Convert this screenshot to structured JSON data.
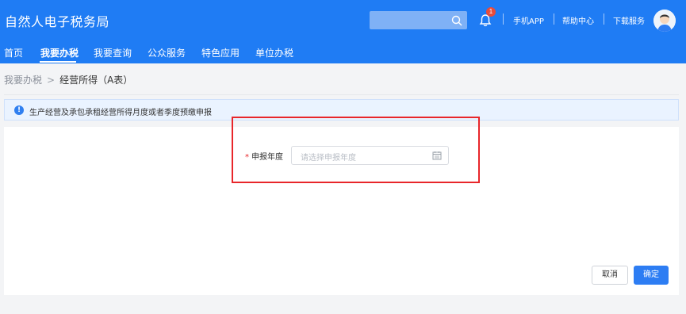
{
  "header": {
    "title": "自然人电子税务局",
    "notification_count": "1",
    "links": [
      "手机APP",
      "帮助中心",
      "下载服务"
    ]
  },
  "nav": {
    "items": [
      "首页",
      "我要办税",
      "我要查询",
      "公众服务",
      "特色应用",
      "单位办税"
    ]
  },
  "breadcrumb": {
    "parent": "我要办税",
    "separator": ">",
    "current": "经营所得（A表）"
  },
  "info": {
    "text": "生产经营及承包承租经营所得月度或者季度预缴申报"
  },
  "form": {
    "required_mark": "*",
    "year_label": "申报年度",
    "year_placeholder": "请选择申报年度"
  },
  "buttons": {
    "cancel": "取消",
    "confirm": "确定"
  },
  "colors": {
    "header_bg": "#1f7cf4",
    "highlight": "#e8262a",
    "primary": "#2d7df3"
  }
}
